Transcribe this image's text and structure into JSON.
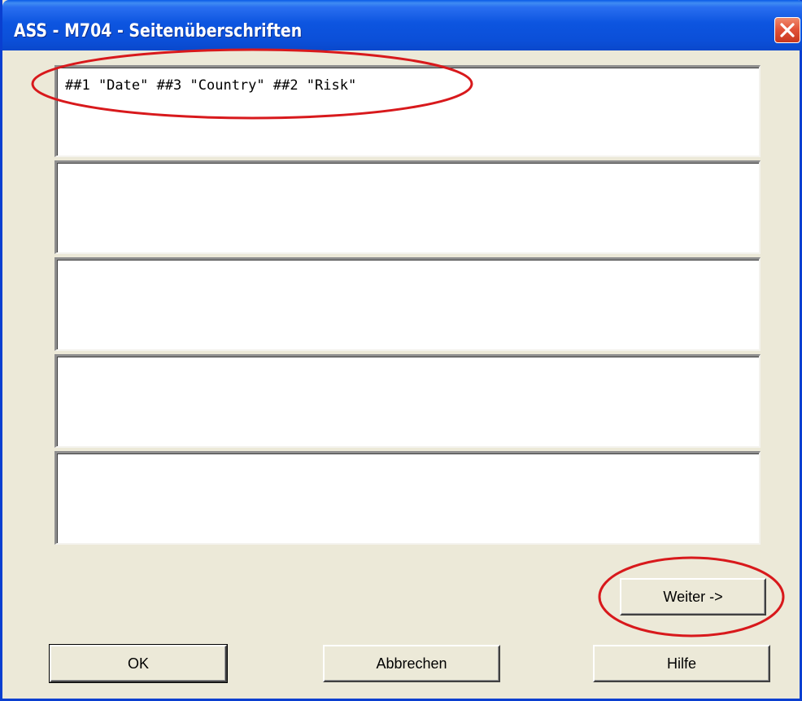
{
  "window": {
    "title": "ASS - M704 - Seitenüberschriften"
  },
  "fields": [
    {
      "value": "##1 \"Date\" ##3 \"Country\" ##2 \"Risk\""
    },
    {
      "value": ""
    },
    {
      "value": ""
    },
    {
      "value": ""
    },
    {
      "value": ""
    }
  ],
  "buttons": {
    "next_label": "Weiter ->",
    "ok_label": "OK",
    "cancel_label": "Abbrechen",
    "help_label": "Hilfe"
  },
  "colors": {
    "title_bar": "#0b52dc",
    "dialog_background": "#ece9d8",
    "annotation_red": "#d8191c"
  }
}
